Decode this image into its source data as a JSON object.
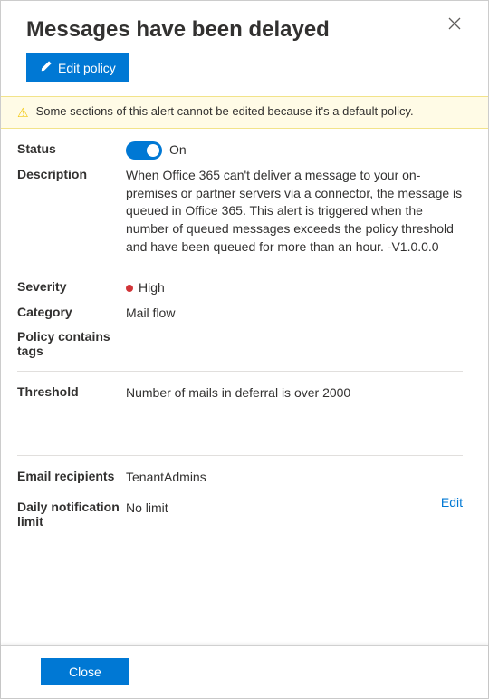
{
  "title": "Messages have been delayed",
  "editButton": "Edit policy",
  "warning": "Some sections of this alert cannot be edited because it's a default policy.",
  "fields": {
    "statusLabel": "Status",
    "statusValue": "On",
    "descriptionLabel": "Description",
    "descriptionValue": "When Office 365 can't deliver a message to your on-premises or partner servers via a connector, the message is queued in Office 365. This alert is triggered when the number of queued messages exceeds the policy threshold and have been queued for more than an hour. -V1.0.0.0",
    "severityLabel": "Severity",
    "severityValue": "High",
    "severityColor": "#d13438",
    "categoryLabel": "Category",
    "categoryValue": "Mail flow",
    "tagsLabel": "Policy contains tags",
    "tagsValue": "",
    "thresholdLabel": "Threshold",
    "thresholdValue": "Number of mails in deferral is over 2000",
    "emailRecipientsLabel": "Email recipients",
    "emailRecipientsValue": "TenantAdmins",
    "dailyLimitLabel": "Daily notification limit",
    "dailyLimitValue": "No limit",
    "editLink": "Edit"
  },
  "footer": {
    "close": "Close"
  }
}
